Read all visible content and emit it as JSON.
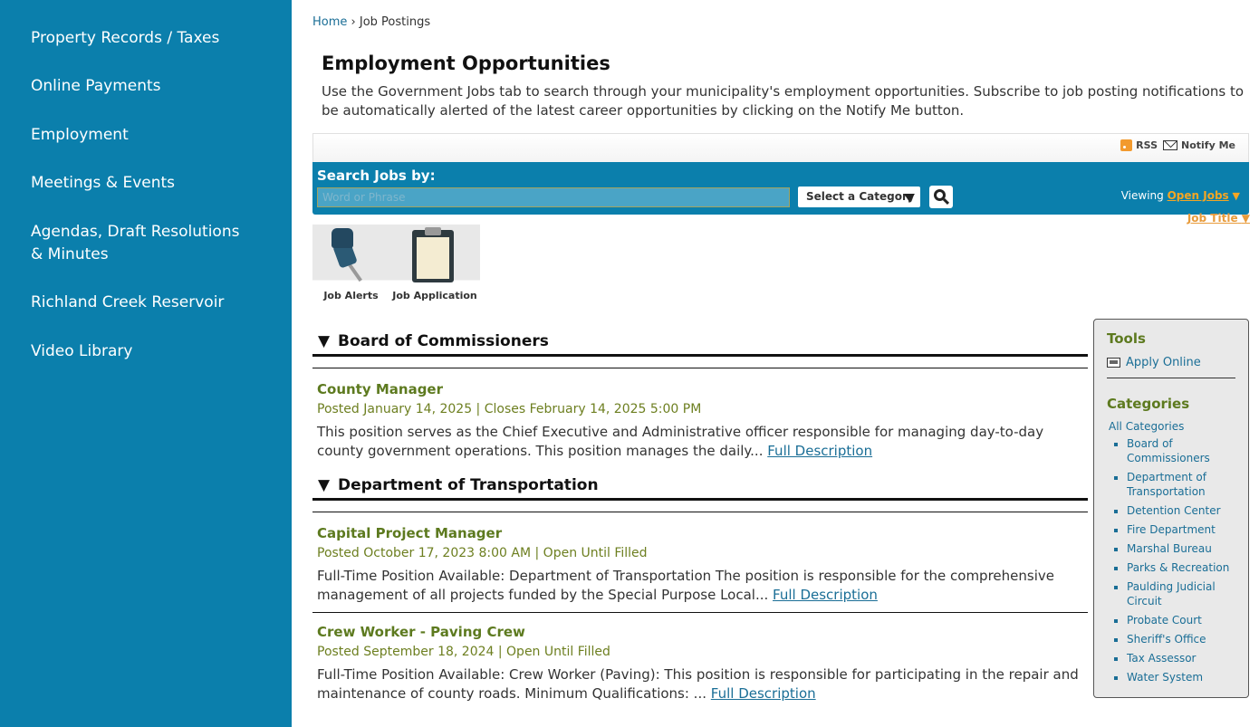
{
  "sidebar": {
    "items": [
      {
        "label": "Property Records / Taxes"
      },
      {
        "label": "Online Payments"
      },
      {
        "label": "Employment"
      },
      {
        "label": "Meetings & Events"
      },
      {
        "label_line1": "Agendas, Draft Resolutions",
        "label_line2": "& Minutes"
      },
      {
        "label": "Richland Creek Reservoir"
      },
      {
        "label": "Video Library"
      }
    ]
  },
  "breadcrumb": {
    "home": "Home",
    "sep": "›",
    "current": "Job Postings"
  },
  "page": {
    "title": "Employment Opportunities",
    "intro": "Use the Government Jobs tab to search through your municipality's employment opportunities. Subscribe to job posting notifications to be automatically alerted of the latest career opportunities by clicking on the Notify Me button."
  },
  "toolbar": {
    "rss": "RSS",
    "notify": "Notify Me"
  },
  "search": {
    "label": "Search Jobs by:",
    "placeholder": "Word or Phrase",
    "category": "Select a Category",
    "viewing_label": "Viewing",
    "viewing_value": "Open Jobs",
    "sort_value": "Job Title",
    "arrow": "▼"
  },
  "tiles": [
    {
      "label": "Job Alerts",
      "icon": "pushpin-icon"
    },
    {
      "label": "Job Application",
      "icon": "clipboard-icon"
    }
  ],
  "categories": [
    {
      "toggle": "▼",
      "name": "Board of Commissioners",
      "jobs": [
        {
          "title": "County Manager",
          "meta": "Posted January 14, 2025 | Closes February 14, 2025 5:00 PM",
          "desc": "This position serves as the Chief Executive and Administrative officer responsible for managing day-to-day county government operations. This position manages the daily...",
          "more": "Full Description"
        }
      ]
    },
    {
      "toggle": "▼",
      "name": "Department of Transportation",
      "jobs": [
        {
          "title": "Capital Project Manager",
          "meta": "Posted October 17, 2023 8:00 AM | Open Until Filled",
          "desc": "Full-Time Position Available: Department of Transportation The position is responsible for the comprehensive management of all projects funded by the Special Purpose Local...",
          "more": "Full Description"
        },
        {
          "title": "Crew Worker - Paving Crew",
          "meta": "Posted September 18, 2024 | Open Until Filled",
          "desc": "Full-Time Position Available: Crew Worker (Paving): This position is responsible for participating in the repair and maintenance of county roads. Minimum Qualifications: ...",
          "more": "Full Description"
        }
      ]
    }
  ],
  "tools": {
    "heading": "Tools",
    "apply": "Apply Online",
    "categories_heading": "Categories",
    "all": "All Categories",
    "list": [
      "Board of Commissioners",
      "Department of Transportation",
      "Detention Center",
      "Fire Department",
      "Marshal Bureau",
      "Parks & Recreation",
      "Paulding Judicial Circuit",
      "Probate Court",
      "Sheriff's Office",
      "Tax Assessor",
      "Water System"
    ]
  },
  "colors": {
    "brand": "#0b7fac",
    "accent": "#f5a623",
    "job_title": "#5d7a1f",
    "link": "#1a6e96"
  }
}
